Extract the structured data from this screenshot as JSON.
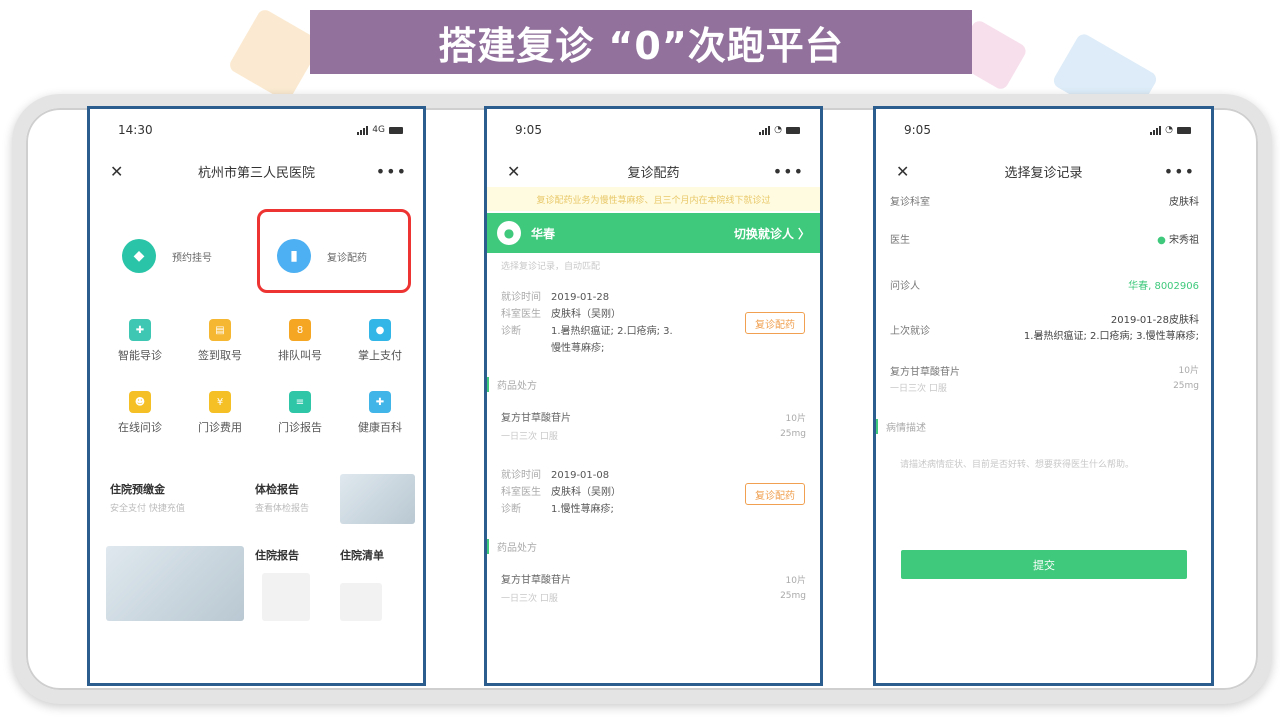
{
  "header": {
    "title": "搭建复诊 “0”次跑平台"
  },
  "colors": {
    "banner": "#92729d",
    "accent_green": "#3fc97c",
    "frame_border": "#2b5d8f",
    "highlight_red": "#ee3333",
    "orange": "#f0a050"
  },
  "phone1": {
    "time": "14:30",
    "network": "4G",
    "title": "杭州市第三人民医院",
    "close_icon": "close-icon",
    "more_icon": "more-icon",
    "top_items": [
      {
        "label": "预约挂号",
        "icon": "diamond-icon",
        "color": "#2ac5a8"
      },
      {
        "label": "复诊配药",
        "icon": "medicine-bottle-icon",
        "color": "#4db0f2"
      }
    ],
    "grid": [
      {
        "label": "智能导诊",
        "color": "#3ec8b4"
      },
      {
        "label": "签到取号",
        "color": "#f5b731"
      },
      {
        "label": "排队叫号",
        "color": "#f5a623"
      },
      {
        "label": "掌上支付",
        "color": "#32b6e8"
      },
      {
        "label": "在线问诊",
        "color": "#f5c026"
      },
      {
        "label": "门诊费用",
        "color": "#f5c026"
      },
      {
        "label": "门诊报告",
        "color": "#2fc6a8"
      },
      {
        "label": "健康百科",
        "color": "#42b5e8"
      }
    ],
    "promo": {
      "deposit_title": "住院预缴金",
      "deposit_sub": "安全支付  快捷充值",
      "checkup_title": "体检报告",
      "checkup_sub": "查看体检报告",
      "inpatient_report": "住院报告",
      "inpatient_list": "住院清单"
    }
  },
  "phone2": {
    "time": "9:05",
    "title": "复诊配药",
    "notice": "复诊配药业务为慢性荨麻疹、且三个月内在本院线下就诊过",
    "patient": "华春",
    "switch": "切换就诊人 〉",
    "faint_header": "选择复诊记录，自动匹配",
    "records": [
      {
        "time_label": "就诊时间",
        "time": "2019-01-28",
        "doc_label": "科室医生",
        "doc": "皮肤科（吴刚）",
        "diag_label": "诊断",
        "diag": "1.暑热织瘟证; 2.口疮病; 3.慢性荨麻疹;",
        "button": "复诊配药",
        "rx_label": "药品处方",
        "drug": "复方甘草酸苷片",
        "usage": "一日三次  口服",
        "qty": "10片",
        "dose": "25mg"
      },
      {
        "time_label": "就诊时间",
        "time": "2019-01-08",
        "doc_label": "科室医生",
        "doc": "皮肤科（吴刚）",
        "diag_label": "诊断",
        "diag": "1.慢性荨麻疹;",
        "button": "复诊配药",
        "rx_label": "药品处方",
        "drug": "复方甘草酸苷片",
        "usage": "一日三次  口服",
        "qty": "10片",
        "dose": "25mg"
      }
    ]
  },
  "phone3": {
    "time": "9:05",
    "title": "选择复诊记录",
    "dept_label": "复诊科室",
    "dept": "皮肤科",
    "doctor_label": "医生",
    "doctor": "宋秀祖",
    "patient_label": "问诊人",
    "patient": "华春, 8002906",
    "last_label": "上次就诊",
    "last_line1": "2019-01-28皮肤科",
    "last_line2": "1.暑热织瘟证; 2.口疮病; 3.慢性荨麻疹;",
    "drug": "复方甘草酸苷片",
    "usage": "一日三次  口服",
    "qty": "10片",
    "dose": "25mg",
    "desc_label": "病情描述",
    "desc_placeholder": "请描述病情症状、目前是否好转、想要获得医生什么帮助。",
    "submit": "提交"
  }
}
